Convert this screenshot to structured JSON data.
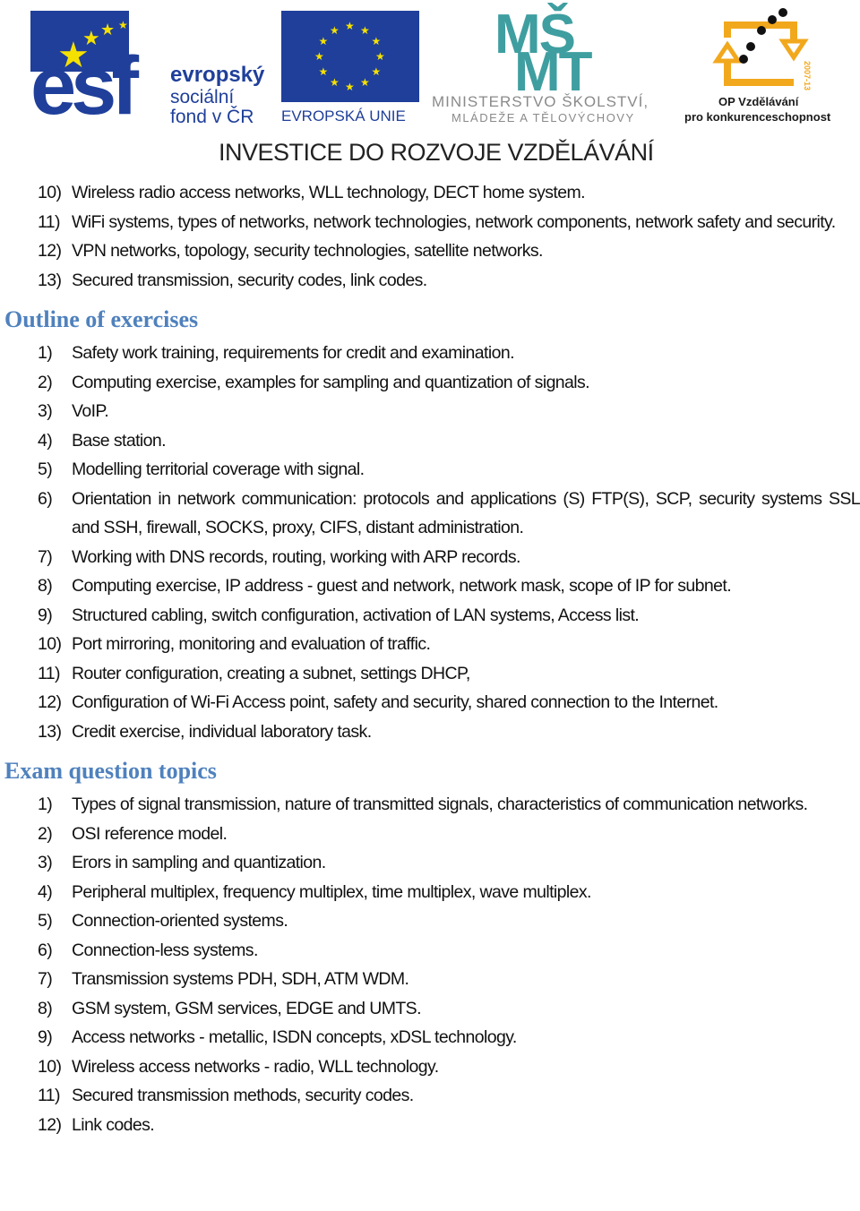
{
  "header": {
    "esf_logo": {
      "letters": "esf",
      "line1": "evropský",
      "line2": "sociální",
      "line3": "fond v ČR"
    },
    "eu_logo": {
      "label": "EVROPSKÁ UNIE"
    },
    "msmt_logo": {
      "mark_top": "MŠ",
      "mark_bottom": "MT",
      "line1": "MINISTERSTVO ŠKOLSTVÍ,",
      "line2": "MLÁDEŽE A TĚLOVÝCHOVY"
    },
    "op_logo": {
      "years": "2007-13",
      "line1": "OP Vzdělávání",
      "line2": "pro konkurenceschopnost"
    },
    "banner": "INVESTICE DO ROZVOJE VZDĚLÁVÁNÍ"
  },
  "colors": {
    "heading": "#4f81bd",
    "esf_blue": "#1f3f9a",
    "star_yellow": "#f5e100",
    "msmt_teal": "#3f9ea0",
    "op_orange": "#f2a81d"
  },
  "lectures_continued": [
    {
      "num": "10)",
      "text": "Wireless radio access networks,  WLL technology,  DECT home system."
    },
    {
      "num": "11)",
      "text": "WiFi systems, types of networks, network technologies, network components, network safety and security."
    },
    {
      "num": "12)",
      "text": "VPN networks, topology, security technologies, satellite networks."
    },
    {
      "num": "13)",
      "text": "Secured transmission, security codes, link codes."
    }
  ],
  "exercises": {
    "title": "Outline of exercises",
    "items": [
      {
        "num": "1)",
        "text": "Safety work training, requirements for credit and examination."
      },
      {
        "num": "2)",
        "text": "Computing exercise, examples for sampling and quantization of signals."
      },
      {
        "num": "3)",
        "text": "VoIP."
      },
      {
        "num": "4)",
        "text": "Base station."
      },
      {
        "num": "5)",
        "text": "Modelling territorial coverage  with signal."
      },
      {
        "num": "6)",
        "text": "Orientation in network communication: protocols and applications (S) FTP(S), SCP, security systems SSL and SSH, firewall, SOCKS, proxy, CIFS, distant administration."
      },
      {
        "num": "7)",
        "text": "Working with  DNS records, routing, working with  ARP records."
      },
      {
        "num": "8)",
        "text": "Computing exercise, IP address - guest and network, network mask, scope of IP for subnet."
      },
      {
        "num": "9)",
        "text": "Structured cabling, switch configuration, activation of  LAN systems, Access list."
      },
      {
        "num": "10)",
        "text": "Port mirroring, monitoring and evaluation of traffic."
      },
      {
        "num": "11)",
        "text": "Router configuration, creating a subnet, settings DHCP,"
      },
      {
        "num": "12)",
        "text": "Configuration of  Wi-Fi Access point, safety and security, shared connection to the Internet."
      },
      {
        "num": "13)",
        "text": "Credit exercise, individual laboratory task."
      }
    ]
  },
  "exam": {
    "title": "Exam question topics",
    "items": [
      {
        "num": "1)",
        "text": "Types of signal transmission, nature of transmitted signals, characteristics of communication networks."
      },
      {
        "num": "2)",
        "text": "OSI reference model."
      },
      {
        "num": "3)",
        "text": "Erors in sampling and quantization."
      },
      {
        "num": "4)",
        "text": "Peripheral multiplex, frequency multiplex, time multiplex, wave multiplex."
      },
      {
        "num": "5)",
        "text": "Connection-oriented systems."
      },
      {
        "num": "6)",
        "text": "Connection-less systems."
      },
      {
        "num": "7)",
        "text": "Transmission systems PDH, SDH, ATM WDM."
      },
      {
        "num": "8)",
        "text": "GSM system, GSM services, EDGE and UMTS."
      },
      {
        "num": "9)",
        "text": "Access networks - metallic,  ISDN concepts,  xDSL technology."
      },
      {
        "num": "10)",
        "text": "Wireless access networks - radio,  WLL technology."
      },
      {
        "num": "11)",
        "text": "Secured transmission methods, security codes."
      },
      {
        "num": "12)",
        "text": "Link codes."
      }
    ]
  }
}
